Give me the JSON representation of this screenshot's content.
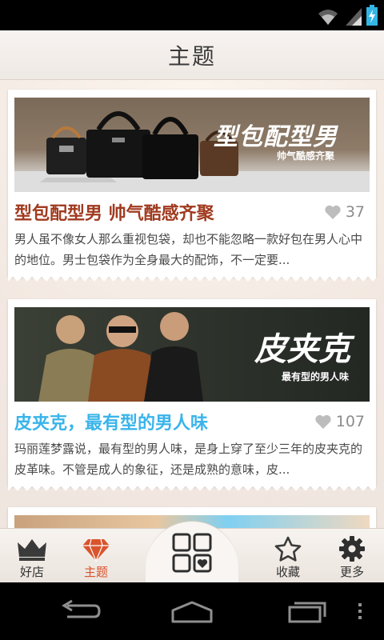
{
  "status_bar": {
    "icons": [
      "wifi-icon",
      "signal-icon",
      "battery-charging-icon"
    ]
  },
  "header": {
    "title": "主题"
  },
  "cards": [
    {
      "banner_title": "型包配型男",
      "banner_subtitle": "帅气酷感齐聚",
      "title": "型包配型男 帅气酷感齐聚",
      "title_color": "#a03a1f",
      "likes": "37",
      "description": "男人虽不像女人那么重视包袋，却也不能忽略一款好包在男人心中的地位。男士包袋作为全身最大的配饰，不一定要..."
    },
    {
      "banner_title": "皮夹克",
      "banner_subtitle": "最有型的男人味",
      "title": "皮夹克，最有型的男人味",
      "title_color": "#3ab4ea",
      "likes": "107",
      "description": "玛丽莲梦露说，最有型的男人味，是身上穿了至少三年的皮夹克的皮革味。不管是成人的象征，还是成熟的意味，皮..."
    }
  ],
  "tab_bar": {
    "tabs": [
      {
        "label": "好店",
        "icon": "crown-icon"
      },
      {
        "label": "主题",
        "icon": "diamond-icon",
        "active": true
      },
      {
        "label": "",
        "icon": "grid-heart-icon"
      },
      {
        "label": "收藏",
        "icon": "star-icon"
      },
      {
        "label": "更多",
        "icon": "gear-icon"
      }
    ],
    "active_color": "#d9542d"
  },
  "nav_bar": {
    "buttons": [
      "back-icon",
      "home-icon",
      "recent-apps-icon",
      "overflow-menu-icon"
    ]
  }
}
